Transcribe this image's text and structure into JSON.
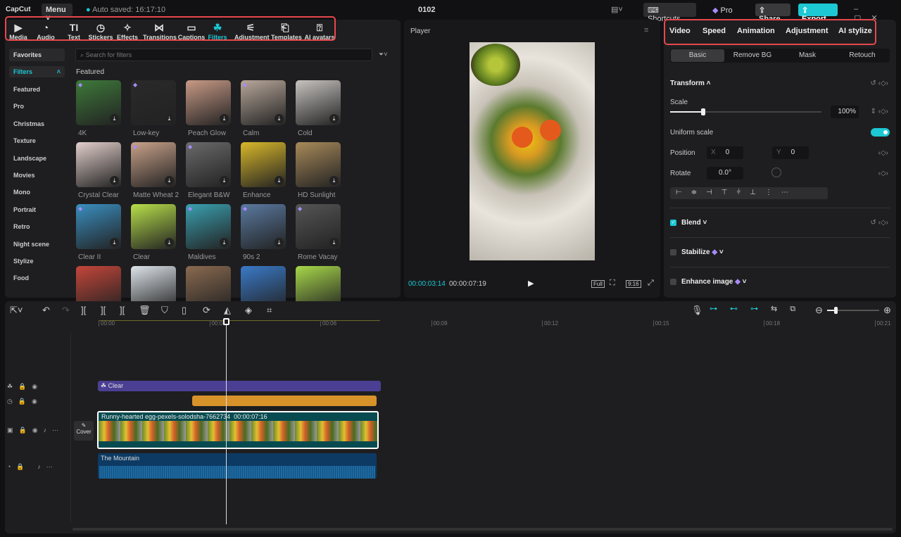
{
  "app": {
    "logo": "CapCut",
    "menu": "Menu",
    "autosave": "Auto saved: 16:17:10",
    "project": "0102",
    "shortcuts": "Shortcuts",
    "pro": "Pro",
    "share": "Share",
    "export": "Export"
  },
  "toolbar": [
    {
      "label": "Media",
      "icon": "▶"
    },
    {
      "label": "Audio",
      "icon": "◔"
    },
    {
      "label": "Text",
      "icon": "TI"
    },
    {
      "label": "Stickers",
      "icon": "◷"
    },
    {
      "label": "Effects",
      "icon": "✧"
    },
    {
      "label": "Transitions",
      "icon": "⋈"
    },
    {
      "label": "Captions",
      "icon": "▭"
    },
    {
      "label": "Filters",
      "icon": "☘"
    },
    {
      "label": "Adjustment",
      "icon": "⚟"
    },
    {
      "label": "Templates",
      "icon": "⎗"
    },
    {
      "label": "AI avatars",
      "icon": "⍰"
    }
  ],
  "sidebar": {
    "favorites": "Favorites",
    "filters": "Filters",
    "items": [
      "Featured",
      "Pro",
      "Christmas",
      "Texture",
      "Landscape",
      "Movies",
      "Mono",
      "Portrait",
      "Retro",
      "Night scene",
      "Stylize",
      "Food"
    ]
  },
  "search": {
    "placeholder": "Search for filters"
  },
  "section": "Featured",
  "filters": [
    {
      "name": "4K",
      "color": "#3e7a3a"
    },
    {
      "name": "Low-key",
      "color": "#2a2a2a"
    },
    {
      "name": "Peach Glow",
      "color": "#c89a86"
    },
    {
      "name": "Calm",
      "color": "#b8a79a"
    },
    {
      "name": "Cold",
      "color": "#c7c3c0"
    },
    {
      "name": "Crystal Clear",
      "color": "#e2cfcb"
    },
    {
      "name": "Matte Wheat 2",
      "color": "#c9a28a"
    },
    {
      "name": "Elegant B&W",
      "color": "#6a6a6a"
    },
    {
      "name": "Enhance",
      "color": "#d9b82a"
    },
    {
      "name": "HD Sunlight",
      "color": "#a88a5a"
    },
    {
      "name": "Clear II",
      "color": "#3a8fc0"
    },
    {
      "name": "Clear",
      "color": "#b8e04a"
    },
    {
      "name": "Maldives",
      "color": "#3aa0b0"
    },
    {
      "name": "90s 2",
      "color": "#5a7aa0"
    },
    {
      "name": "Rome Vacay",
      "color": "#555555"
    },
    {
      "name": "",
      "color": "#c4463a"
    },
    {
      "name": "",
      "color": "#dde4ea"
    },
    {
      "name": "",
      "color": "#8a6a50"
    },
    {
      "name": "",
      "color": "#3a7ac8"
    },
    {
      "name": "",
      "color": "#a8d84a"
    }
  ],
  "player": {
    "title": "Player",
    "current": "00:00:03:14",
    "total": "00:00:07:19",
    "full": "Full",
    "ratio": "9:16"
  },
  "right": {
    "tabs": [
      "Video",
      "Speed",
      "Animation",
      "Adjustment",
      "AI stylize"
    ],
    "subtabs": [
      "Basic",
      "Remove BG",
      "Mask",
      "Retouch"
    ],
    "transform": "Transform",
    "scale": "Scale",
    "scale_value": "100%",
    "scale_fraction": 0.22,
    "uniform": "Uniform scale",
    "uniform_on": true,
    "position": "Position",
    "x_label": "X",
    "x": "0",
    "y_label": "Y",
    "y": "0",
    "rotate": "Rotate",
    "rotate_value": "0.0°",
    "blend": "Blend",
    "blend_checked": true,
    "stabilize": "Stabilize",
    "enhance": "Enhance image"
  },
  "timeline": {
    "ticks": [
      "00:00",
      "00:03",
      "00:06",
      "00:09",
      "00:12",
      "00:15",
      "00:18",
      "00:21"
    ],
    "filter_clip": "Clear",
    "video_clip": "Runny-hearted egg-pexels-solodsha-7662734",
    "video_duration": "00:00:07:16",
    "audio_clip": "The Mountain",
    "cover": "Cover"
  }
}
